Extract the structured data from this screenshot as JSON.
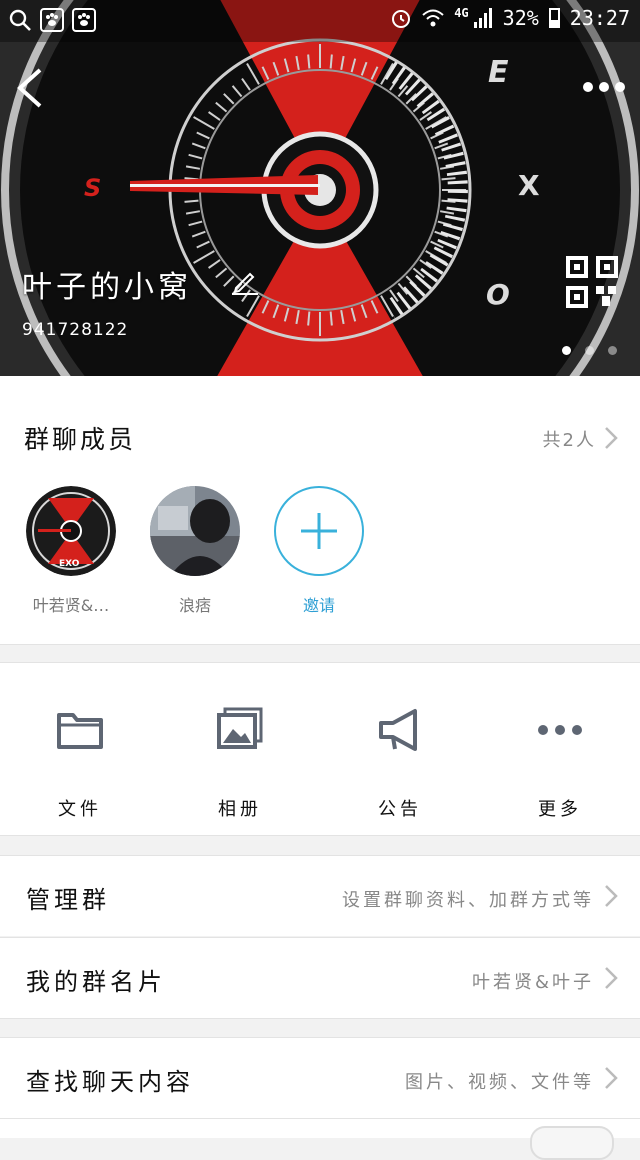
{
  "status_bar": {
    "network": "4G",
    "battery": "32%",
    "time": "23:27",
    "icons": [
      "search-icon",
      "baidu-paw-icon",
      "baidu-paw-icon",
      "alarm-icon",
      "wifi-icon",
      "signal-icon",
      "battery-icon"
    ]
  },
  "header": {
    "group_name": "叶子的小窝",
    "group_id": "941728122",
    "logo_text": {
      "e": "E",
      "x": "X",
      "o": "O",
      "s": "S"
    }
  },
  "members": {
    "title": "群聊成员",
    "count": "共2人",
    "list": [
      {
        "name": "叶若贤&…"
      },
      {
        "name": "浪痞"
      }
    ],
    "invite_label": "邀请",
    "avatar_logo_text": "EXO"
  },
  "actions": [
    {
      "label": "文件",
      "icon": "folder-icon"
    },
    {
      "label": "相册",
      "icon": "album-icon"
    },
    {
      "label": "公告",
      "icon": "megaphone-icon"
    },
    {
      "label": "更多",
      "icon": "more-dots-icon"
    }
  ],
  "settings": [
    {
      "title": "管理群",
      "value": "设置群聊资料、加群方式等"
    },
    {
      "title": "我的群名片",
      "value": "叶若贤&叶子"
    },
    {
      "title": "查找聊天内容",
      "value": "图片、视频、文件等"
    }
  ],
  "colors": {
    "accent": "#39b1db",
    "hero_red": "#d4211c"
  }
}
